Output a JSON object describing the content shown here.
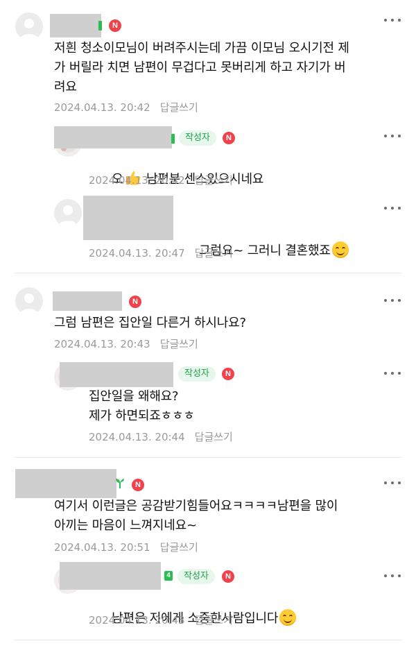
{
  "reply_label": "답글쓰기",
  "author_badge": "작성자",
  "n_badge": "N",
  "level_badge": "4",
  "comments": [
    {
      "text": "저흰 청소이모님이 버려주시는데 가끔 이모님 오시기전 제\n가 버릴라 치면 남편이 무겁다고 못버리게 하고 자기가 버\n려요",
      "date": "2024.04.13. 20:42"
    },
    {
      "text_a": "오",
      "text_b": " 남편분 센스있으시네요",
      "emoji": "thumbs-up",
      "date": "2024.04.13. 20:42"
    },
    {
      "text": "그럼요~ 그러니 결혼했죠",
      "emoji": "smiling-face",
      "date": "2024.04.13. 20:47"
    },
    {
      "text": "그럼 남편은 집안일 다른거 하시나요?",
      "date": "2024.04.13. 20:43"
    },
    {
      "text": "집안일을 왜해요?\n제가 하면되죠ㅎㅎㅎ",
      "date": "2024.04.13. 20:44"
    },
    {
      "text": "여기서 이런글은 공감받기힘들어요ㅋㅋㅋㅋ남편을 많이\n아끼는 마음이 느껴지네요~",
      "date": "2024.04.13. 20:51"
    },
    {
      "text": "남편은 저에게 소중한사람입니다",
      "emoji": "smiling-face",
      "date": "2024.04.13. 20:43"
    }
  ]
}
